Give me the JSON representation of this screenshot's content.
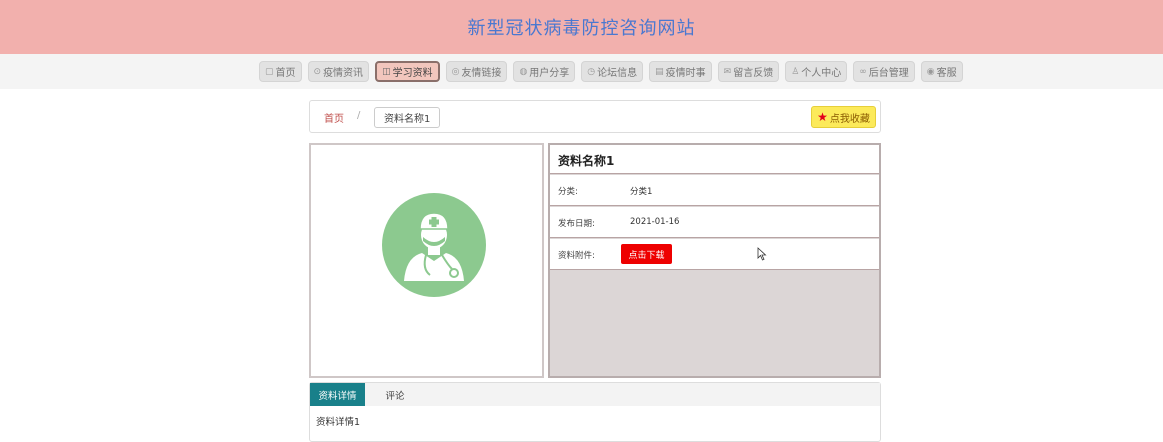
{
  "site": {
    "title": "新型冠状病毒防控咨询网站"
  },
  "nav": {
    "items": [
      {
        "label": "首页",
        "icon": "home-icon",
        "glyph": "▢"
      },
      {
        "label": "疫情资讯",
        "icon": "info-circle-icon",
        "glyph": "⊙"
      },
      {
        "label": "学习资料",
        "icon": "book-icon",
        "glyph": "◫",
        "active": true
      },
      {
        "label": "友情链接",
        "icon": "link-icon",
        "glyph": "◎"
      },
      {
        "label": "用户分享",
        "icon": "share-icon",
        "glyph": "◍"
      },
      {
        "label": "论坛信息",
        "icon": "clock-icon",
        "glyph": "◷"
      },
      {
        "label": "疫情时事",
        "icon": "news-icon",
        "glyph": "▤"
      },
      {
        "label": "留言反馈",
        "icon": "feedback-icon",
        "glyph": "✉"
      },
      {
        "label": "个人中心",
        "icon": "user-icon",
        "glyph": "♙"
      },
      {
        "label": "后台管理",
        "icon": "admin-link-icon",
        "glyph": "∞"
      },
      {
        "label": "客服",
        "icon": "support-icon",
        "glyph": "◉"
      }
    ]
  },
  "breadcrumb": {
    "home": "首页",
    "separator": "/",
    "current": "资料名称1"
  },
  "favorite": {
    "label": "点我收藏",
    "icon": "star-icon"
  },
  "detail": {
    "title": "资料名称1",
    "category_label": "分类:",
    "category_value": "分类1",
    "date_label": "发布日期:",
    "date_value": "2021-01-16",
    "attachment_label": "资料附件:",
    "download_label": "点击下载"
  },
  "tabs": {
    "details_label": "资料详情",
    "comments_label": "评论",
    "content": "资料详情1"
  },
  "colors": {
    "banner": "#f2b0ad",
    "title": "#4a78d0",
    "favorite_bg": "#fcea5a",
    "download_bg": "#ee0000",
    "tab_active": "#19808a",
    "avatar_green": "#8cc98f"
  }
}
